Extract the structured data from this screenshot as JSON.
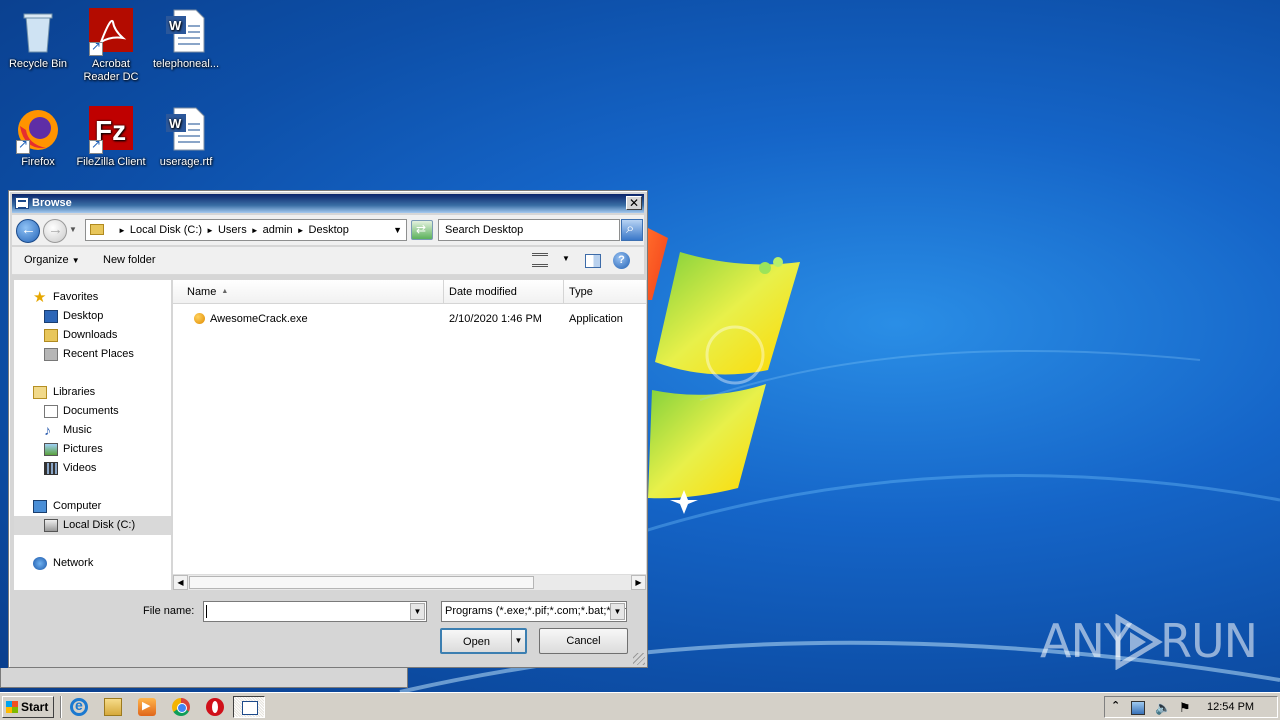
{
  "desktop": {
    "icons": [
      {
        "label": "Recycle Bin",
        "icon": "recycle-bin-icon"
      },
      {
        "label": "Acrobat Reader DC",
        "icon": "acrobat-icon"
      },
      {
        "label": "telephoneal...",
        "icon": "word-doc-icon"
      },
      {
        "label": "Firefox",
        "icon": "firefox-icon"
      },
      {
        "label": "FileZilla Client",
        "icon": "filezilla-icon"
      },
      {
        "label": "userage.rtf",
        "icon": "word-doc-icon"
      }
    ]
  },
  "dialog": {
    "title": "Browse",
    "close": "✕",
    "address": {
      "crumbs": [
        "Local Disk (C:)",
        "Users",
        "admin",
        "Desktop"
      ],
      "separator": "►"
    },
    "search_placeholder": "Search Desktop",
    "toolbar": {
      "organize": "Organize",
      "organize_arrow": "▼",
      "new_folder": "New folder",
      "help": "?"
    },
    "nav": {
      "favorites": "Favorites",
      "desktop": "Desktop",
      "downloads": "Downloads",
      "recent_places": "Recent Places",
      "libraries": "Libraries",
      "documents": "Documents",
      "music": "Music",
      "pictures": "Pictures",
      "videos": "Videos",
      "computer": "Computer",
      "local_disk": "Local Disk (C:)",
      "network": "Network"
    },
    "columns": {
      "name": "Name",
      "date_modified": "Date modified",
      "type": "Type"
    },
    "files": [
      {
        "name": "AwesomeCrack.exe",
        "date": "2/10/2020 1:46 PM",
        "type": "Application"
      }
    ],
    "file_name_label": "File name:",
    "file_name_value": "",
    "filter": "Programs (*.exe;*.pif;*.com;*.bat;*.cmd)",
    "open_button": "Open",
    "cancel_button": "Cancel"
  },
  "taskbar": {
    "start": "Start",
    "tray_up": "⌃",
    "clock": "12:54 PM"
  },
  "watermark": {
    "left": "ANY",
    "right": "RUN"
  }
}
